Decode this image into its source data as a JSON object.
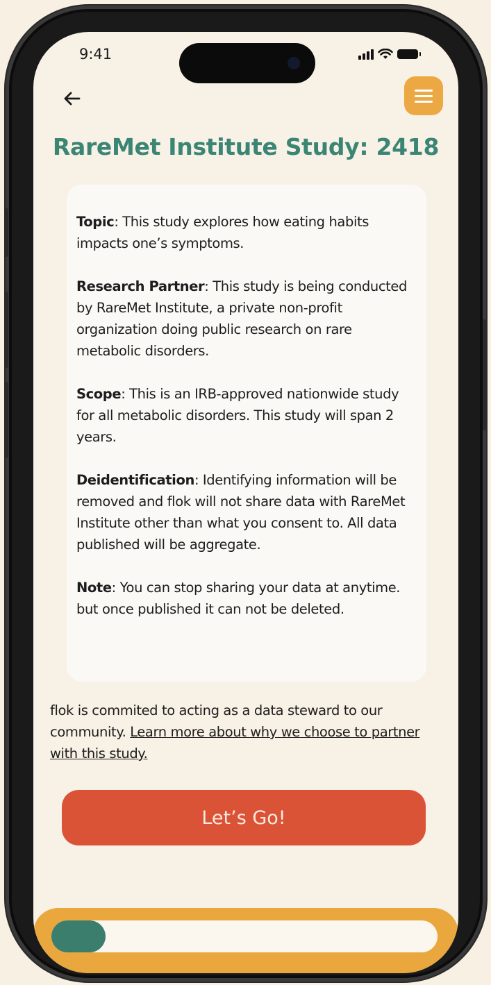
{
  "status_bar": {
    "time": "9:41",
    "icons": [
      "signal-icon",
      "wifi-icon",
      "battery-icon"
    ]
  },
  "header": {
    "back_icon": "arrow-left-icon",
    "menu_icon": "hamburger-menu-icon",
    "title": "RareMet Institute Study: 2418"
  },
  "details": {
    "topic_label": "Topic",
    "topic_text": ": This study explores how eating habits impacts one’s symptoms.",
    "partner_label": "Research Partner",
    "partner_text": ": This study is being conducted by RareMet Institute, a private non-profit organization doing public research on rare metabolic disorders.",
    "scope_label": "Scope",
    "scope_text": ": This is an IRB-approved nationwide study for all metabolic disorders. This study will span 2 years.",
    "deid_label": "Deidentification",
    "deid_text": ": Identifying information will be removed and flok will not share data with RareMet Institute other than what you consent to. All data published will be aggregate.",
    "note_label": "Note",
    "note_text": ": You can stop sharing your data at anytime. but once published it can not be deleted."
  },
  "steward": {
    "text": "flok is commited to acting as a data steward to our community. ",
    "link": "Learn more about why we choose to partner with this study."
  },
  "cta": {
    "label": "Let’s Go!"
  },
  "progress": {
    "fraction": 0.14
  },
  "colors": {
    "title": "#3b8575",
    "accent": "#eca842",
    "cta": "#db5337",
    "progress_fill": "#3b7e6d"
  }
}
